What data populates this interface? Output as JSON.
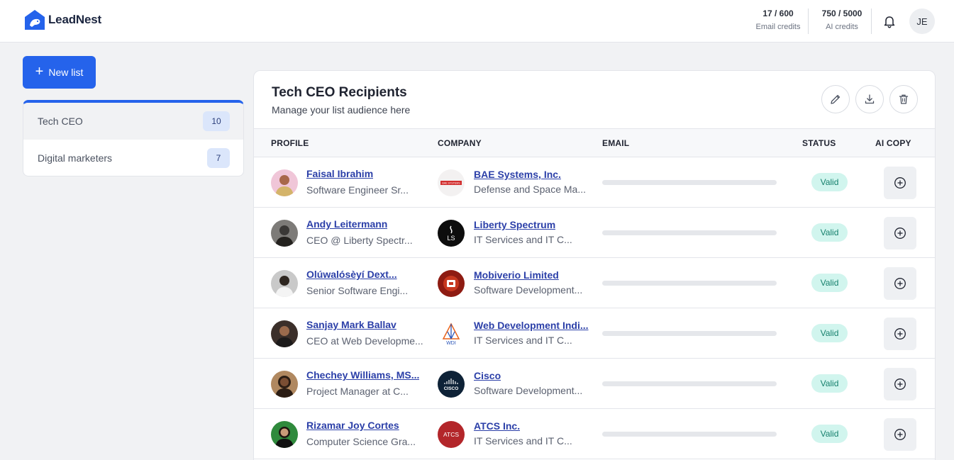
{
  "app": {
    "name": "LeadNest"
  },
  "credits": {
    "email": {
      "value": "17 / 600",
      "label": "Email credits"
    },
    "ai": {
      "value": "750 / 5000",
      "label": "AI credits"
    }
  },
  "user": {
    "initials": "JE"
  },
  "sidebar": {
    "new_list_label": "New list",
    "lists": [
      {
        "name": "Tech CEO",
        "count": "10",
        "active": true
      },
      {
        "name": "Digital marketers",
        "count": "7",
        "active": false
      }
    ]
  },
  "main": {
    "title": "Tech CEO Recipients",
    "subtitle": "Manage your list audience here",
    "columns": [
      "PROFILE",
      "COMPANY",
      "EMAIL",
      "STATUS",
      "AI COPY"
    ],
    "rows": [
      {
        "name": "Faisal Ibrahim",
        "title": "Software Engineer Sr...",
        "company": "BAE Systems, Inc.",
        "industry": "Defense and Space Ma...",
        "status": "Valid"
      },
      {
        "name": "Andy Leitermann",
        "title": "CEO @ Liberty Spectr...",
        "company": "Liberty Spectrum",
        "industry": "IT Services and IT C...",
        "status": "Valid"
      },
      {
        "name": "Olúwalósèyí Dext...",
        "title": "Senior Software Engi...",
        "company": "Mobiverio Limited",
        "industry": "Software Development...",
        "status": "Valid"
      },
      {
        "name": "Sanjay Mark Ballav",
        "title": "CEO at Web Developme...",
        "company": "Web Development Indi...",
        "industry": "IT Services and IT C...",
        "status": "Valid"
      },
      {
        "name": "Chechey Williams, MS...",
        "title": "Project Manager at C...",
        "company": "Cisco",
        "industry": "Software Development...",
        "status": "Valid"
      },
      {
        "name": "Rizamar Joy Cortes",
        "title": "Computer Science Gra...",
        "company": "ATCS Inc.",
        "industry": "IT Services and IT C...",
        "status": "Valid"
      }
    ]
  },
  "logos": {
    "bae": "BAE SYSTEMS",
    "liberty": "LS",
    "webdev": "WDI",
    "cisco": "CISCO",
    "atcs": "ATCS"
  },
  "icons": {
    "logo": "bird-house-icon",
    "bell": "bell-icon",
    "edit": "pencil-icon",
    "download": "download-icon",
    "delete": "trash-icon",
    "ai_copy": "plus-circle-icon"
  },
  "colors": {
    "accent": "#2563eb",
    "link": "#2b3fa8",
    "status_bg": "#d1f5ee",
    "status_text": "#16806d"
  }
}
